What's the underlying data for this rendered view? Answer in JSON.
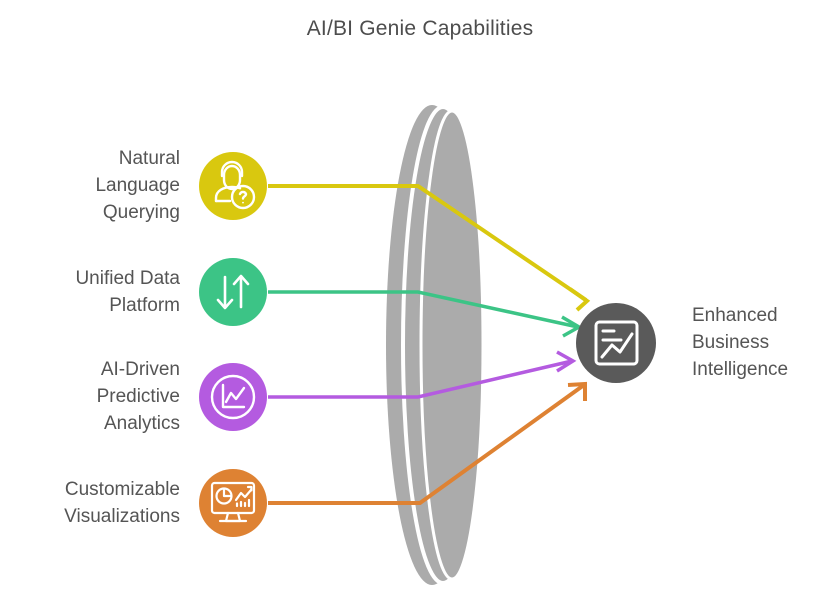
{
  "title": "AI/BI Genie Capabilities",
  "colors": {
    "yellow": "#D9C80F",
    "green": "#3CC486",
    "purple": "#B койот",
    "purple_fix": "#B45BE0",
    "orange": "#DE8233",
    "target_gray": "#5A5A5A",
    "lens_gray": "#ABABAB",
    "text": "#555555",
    "title_text": "#4d4d4d",
    "background": "#FFFFFF"
  },
  "capabilities": [
    {
      "label": "Natural\nLanguage\nQuerying",
      "icon": "person-question-icon",
      "color": "#D9C80F"
    },
    {
      "label": "Unified Data\nPlatform",
      "icon": "up-down-arrows-icon",
      "color": "#3CC486"
    },
    {
      "label": "AI-Driven\nPredictive\nAnalytics",
      "icon": "line-chart-circle-icon",
      "color": "#B45BE0"
    },
    {
      "label": "Customizable\nVisualizations",
      "icon": "monitor-dashboard-icon",
      "color": "#DE8233"
    }
  ],
  "outcome": {
    "label": "Enhanced\nBusiness\nIntelligence",
    "icon": "report-chart-icon",
    "color": "#5A5A5A"
  },
  "center_shape": {
    "name": "layered-lens-shape",
    "color": "#ABABAB",
    "layers": 3
  },
  "chart_data": {
    "type": "diagram",
    "title": "AI/BI Genie Capabilities",
    "nodes": [
      {
        "id": "natural-language-querying",
        "label": "Natural Language Querying",
        "color": "#D9C80F"
      },
      {
        "id": "unified-data-platform",
        "label": "Unified Data Platform",
        "color": "#3CC486"
      },
      {
        "id": "ai-driven-predictive-analytics",
        "label": "AI-Driven Predictive Analytics",
        "color": "#B45BE0"
      },
      {
        "id": "customizable-visualizations",
        "label": "Customizable Visualizations",
        "color": "#DE8233"
      },
      {
        "id": "enhanced-business-intelligence",
        "label": "Enhanced Business Intelligence",
        "color": "#5A5A5A"
      }
    ],
    "edges": [
      {
        "from": "natural-language-querying",
        "to": "enhanced-business-intelligence",
        "color": "#D9C80F"
      },
      {
        "from": "unified-data-platform",
        "to": "enhanced-business-intelligence",
        "color": "#3CC486"
      },
      {
        "from": "ai-driven-predictive-analytics",
        "to": "enhanced-business-intelligence",
        "color": "#B45BE0"
      },
      {
        "from": "customizable-visualizations",
        "to": "enhanced-business-intelligence",
        "color": "#DE8233"
      }
    ]
  }
}
